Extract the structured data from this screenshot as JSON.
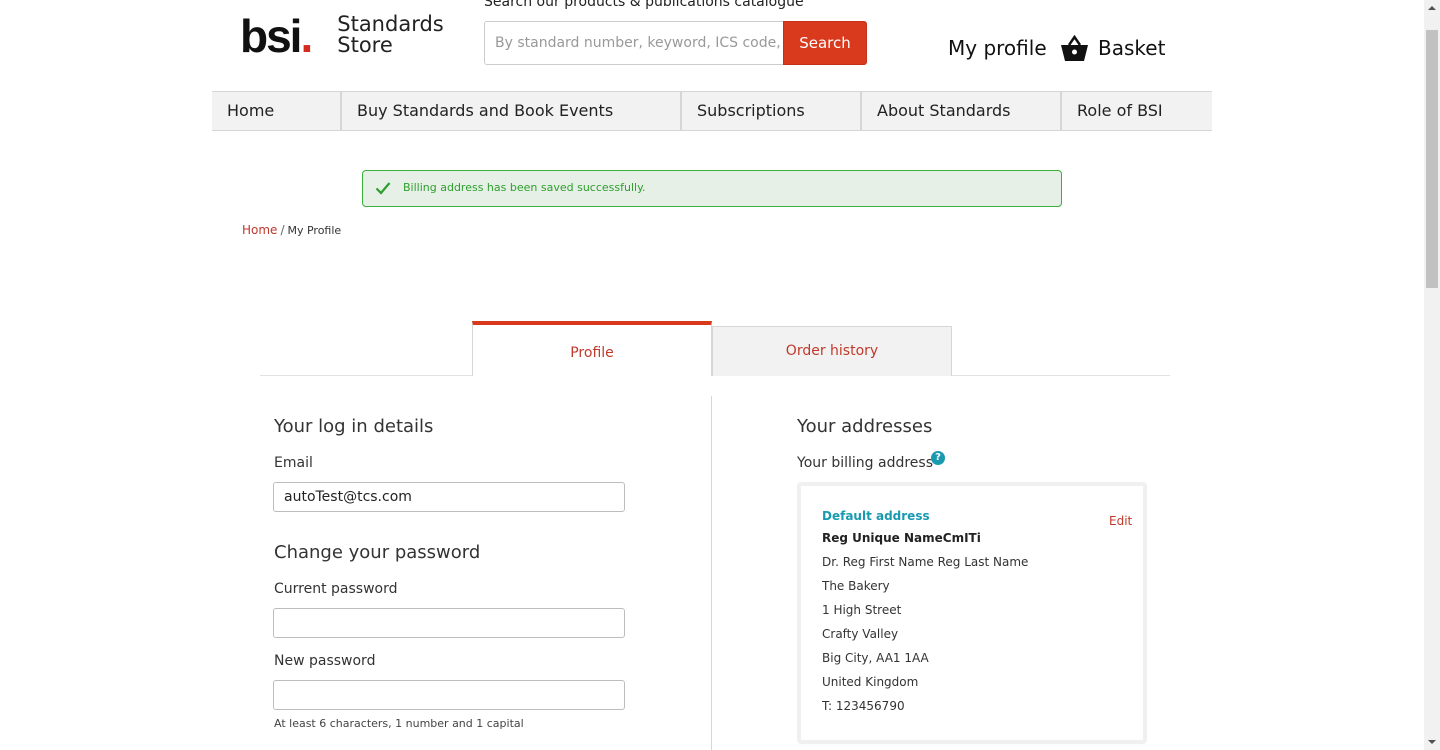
{
  "header": {
    "logo_text": "bsi",
    "logo_dot": ".",
    "store_line1": "Standards",
    "store_line2": "Store",
    "search_caption": "Search our products & publications catalogue",
    "search_placeholder": "By standard number, keyword, ICS code, ISBN",
    "search_button": "Search",
    "my_profile": "My profile",
    "basket": "Basket"
  },
  "nav": {
    "items": [
      {
        "label": "Home"
      },
      {
        "label": "Buy Standards and Book Events"
      },
      {
        "label": "Subscriptions"
      },
      {
        "label": "About Standards"
      },
      {
        "label": "Role of BSI"
      }
    ]
  },
  "alert": {
    "message": "Billing address has been saved successfully.",
    "color": "#3bb03b"
  },
  "breadcrumb": {
    "home": "Home",
    "separator": "/",
    "current": "My Profile"
  },
  "tabs": {
    "profile": "Profile",
    "order_history": "Order history",
    "accent": "#d9391c"
  },
  "login": {
    "heading": "Your log in details",
    "email_label": "Email",
    "email_value": "autoTest@tcs.com"
  },
  "password": {
    "heading": "Change your password",
    "current_label": "Current password",
    "current_value": "",
    "new_label": "New password",
    "new_value": "",
    "hint": "At least 6 characters, 1 number and 1 capital"
  },
  "addresses": {
    "heading": "Your addresses",
    "billing_label": "Your billing address",
    "help_icon": "?",
    "card": {
      "default_label": "Default address",
      "edit": "Edit",
      "company": "Reg Unique NameCmITi",
      "lines": [
        "Dr. Reg First Name Reg Last Name",
        "The Bakery",
        "1 High Street",
        "Crafty Valley",
        "Big City, AA1 1AA",
        "United Kingdom",
        "T: 123456790"
      ]
    }
  }
}
